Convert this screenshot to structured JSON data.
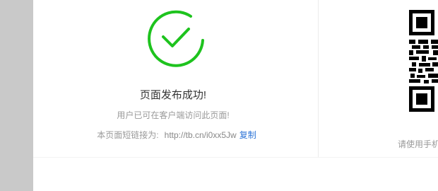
{
  "result": {
    "title": "页面发布成功!",
    "description": "用户已可在客户端访问此页面!",
    "short_link_label": "本页面短链接为:",
    "short_link_url": "http://tb.cn/i0xx5Jw",
    "copy_label": "复制"
  },
  "qr_panel": {
    "hint": "请使用手机"
  },
  "colors": {
    "success": "#1ec31e",
    "link": "#2f76d7",
    "sidebar": "#c9c9c9"
  },
  "icons": {
    "success": "check-circle-icon",
    "qr": "qr-code"
  }
}
